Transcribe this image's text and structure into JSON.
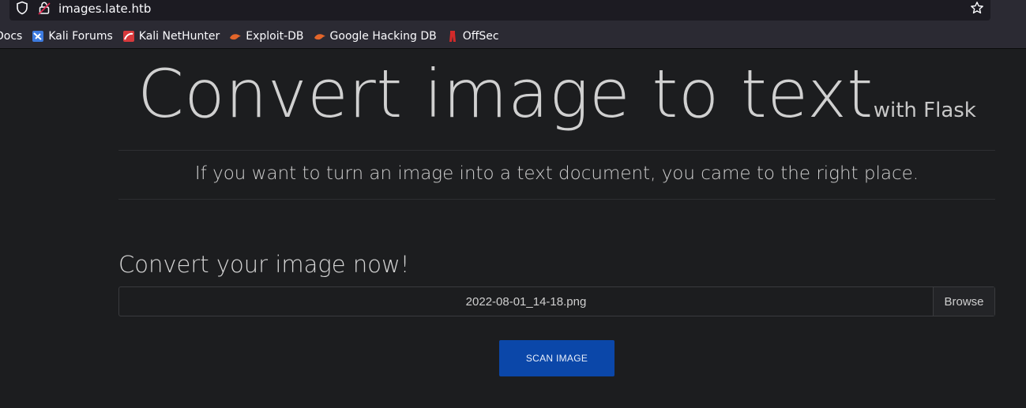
{
  "browser": {
    "url": "images.late.htb",
    "bookmarks": [
      {
        "label": "Docs",
        "icon": "docs-icon"
      },
      {
        "label": "Kali Forums",
        "icon": "kali-forums-icon",
        "color": "#3d7be0"
      },
      {
        "label": "Kali NetHunter",
        "icon": "kali-nethunter-icon",
        "color": "#d8393c"
      },
      {
        "label": "Exploit-DB",
        "icon": "exploit-db-icon",
        "color": "#e2652a"
      },
      {
        "label": "Google Hacking DB",
        "icon": "ghdb-icon",
        "color": "#e2652a"
      },
      {
        "label": "OffSec",
        "icon": "offsec-icon",
        "color": "#d32a2a"
      }
    ]
  },
  "page": {
    "title": "Convert image to text",
    "title_suffix": "with Flask",
    "lead": "If you want to turn an image into a text document, you came to the right place.",
    "section_title": "Convert your image now!",
    "file_input": {
      "value": "2022-08-01_14-18.png",
      "browse_label": "Browse"
    },
    "scan_button": "SCAN IMAGE",
    "colors": {
      "background": "#1c1d1f",
      "primary_button": "#0b47a9"
    }
  }
}
